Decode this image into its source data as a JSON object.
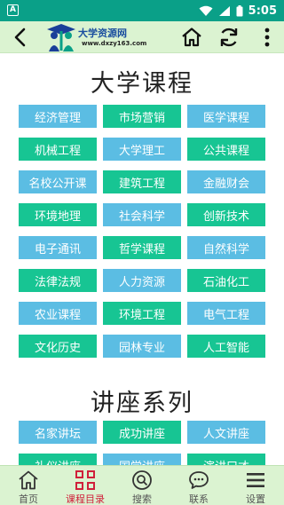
{
  "status_bar": {
    "left_icon_letter": "A",
    "time": "5:05",
    "icons": [
      "wifi-icon",
      "signal-icon",
      "battery-icon"
    ]
  },
  "header": {
    "logo_title": "大学资源网",
    "logo_url": "www.dxzy163.com",
    "icons": [
      "back-icon",
      "home-icon",
      "refresh-icon",
      "more-icon"
    ]
  },
  "colors": {
    "status_bar_bg": "#0aa088",
    "header_bg": "#dbf3d1",
    "button_blue": "#5bbde3",
    "button_green": "#17c593",
    "active_tab": "#d0203a"
  },
  "sections": [
    {
      "title": "大学课程",
      "items": [
        {
          "label": "经济管理",
          "color": "blue"
        },
        {
          "label": "市场营销",
          "color": "green"
        },
        {
          "label": "医学课程",
          "color": "blue"
        },
        {
          "label": "机械工程",
          "color": "green"
        },
        {
          "label": "大学理工",
          "color": "blue"
        },
        {
          "label": "公共课程",
          "color": "green"
        },
        {
          "label": "名校公开课",
          "color": "blue"
        },
        {
          "label": "建筑工程",
          "color": "green"
        },
        {
          "label": "金融财会",
          "color": "blue"
        },
        {
          "label": "环境地理",
          "color": "green"
        },
        {
          "label": "社会科学",
          "color": "blue"
        },
        {
          "label": "创新技术",
          "color": "green"
        },
        {
          "label": "电子通讯",
          "color": "blue"
        },
        {
          "label": "哲学课程",
          "color": "green"
        },
        {
          "label": "自然科学",
          "color": "blue"
        },
        {
          "label": "法律法规",
          "color": "green"
        },
        {
          "label": "人力资源",
          "color": "blue"
        },
        {
          "label": "石油化工",
          "color": "green"
        },
        {
          "label": "农业课程",
          "color": "blue"
        },
        {
          "label": "环境工程",
          "color": "green"
        },
        {
          "label": "电气工程",
          "color": "blue"
        },
        {
          "label": "文化历史",
          "color": "green"
        },
        {
          "label": "园林专业",
          "color": "blue"
        },
        {
          "label": "人工智能",
          "color": "green"
        }
      ]
    },
    {
      "title": "讲座系列",
      "items": [
        {
          "label": "名家讲坛",
          "color": "blue"
        },
        {
          "label": "成功讲座",
          "color": "green"
        },
        {
          "label": "人文讲座",
          "color": "blue"
        },
        {
          "label": "礼仪讲座",
          "color": "green"
        },
        {
          "label": "国学讲座",
          "color": "blue"
        },
        {
          "label": "演讲口才",
          "color": "green"
        }
      ]
    }
  ],
  "bottom_nav": [
    {
      "label": "首页",
      "icon": "home-icon",
      "active": false
    },
    {
      "label": "课程目录",
      "icon": "grid-icon",
      "active": true
    },
    {
      "label": "搜索",
      "icon": "search-icon",
      "active": false
    },
    {
      "label": "联系",
      "icon": "chat-icon",
      "active": false
    },
    {
      "label": "设置",
      "icon": "menu-icon",
      "active": false
    }
  ]
}
